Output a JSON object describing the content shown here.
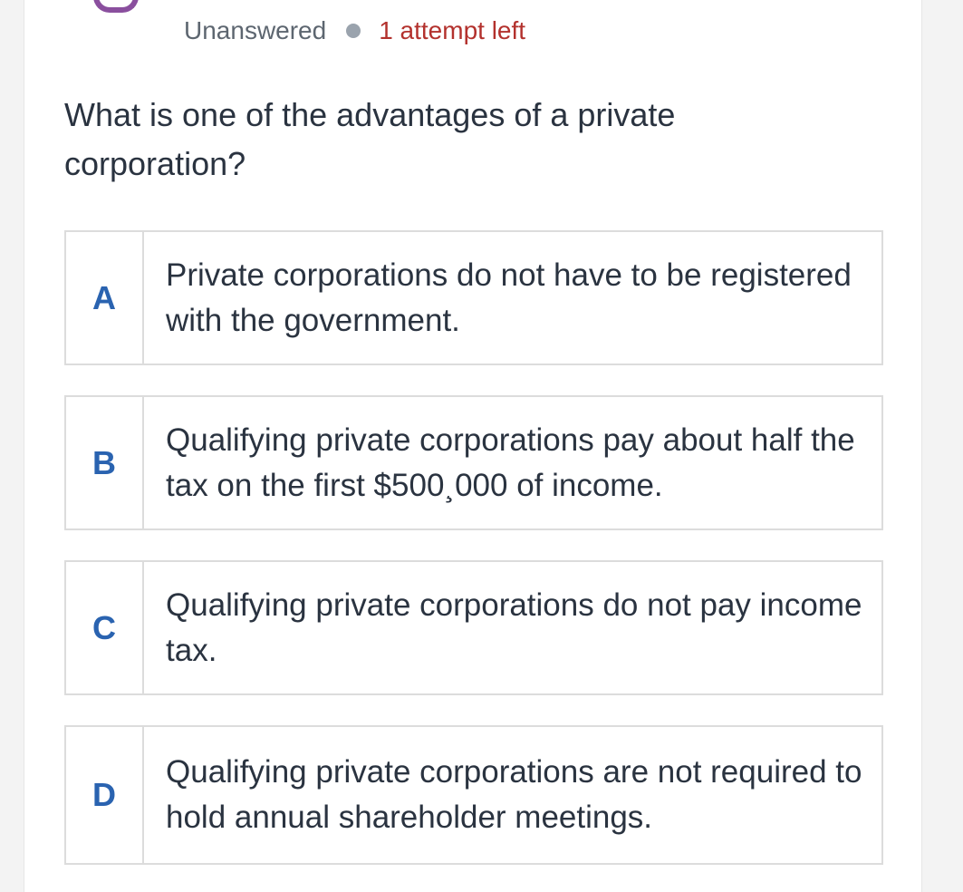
{
  "status": {
    "state": "Unanswered",
    "attempts": "1 attempt left",
    "dot_color": "#9aa3ad",
    "attempts_color": "#b3312d"
  },
  "question": {
    "text": "What is one of the advantages of a private corporation?"
  },
  "options": [
    {
      "letter": "A",
      "text": "Private corporations do not have to be registered with the government."
    },
    {
      "letter": "B",
      "text": "Qualifying private corporations pay about half the tax on the first $500¸000 of income."
    },
    {
      "letter": "C",
      "text": "Qualifying private corporations do not pay income tax."
    },
    {
      "letter": "D",
      "text": "Qualifying private corporations are not required to hold annual shareholder meetings."
    }
  ],
  "colors": {
    "letter": "#2a63b0",
    "border": "#dcdcdc",
    "avatar": "#8a4f9e"
  }
}
